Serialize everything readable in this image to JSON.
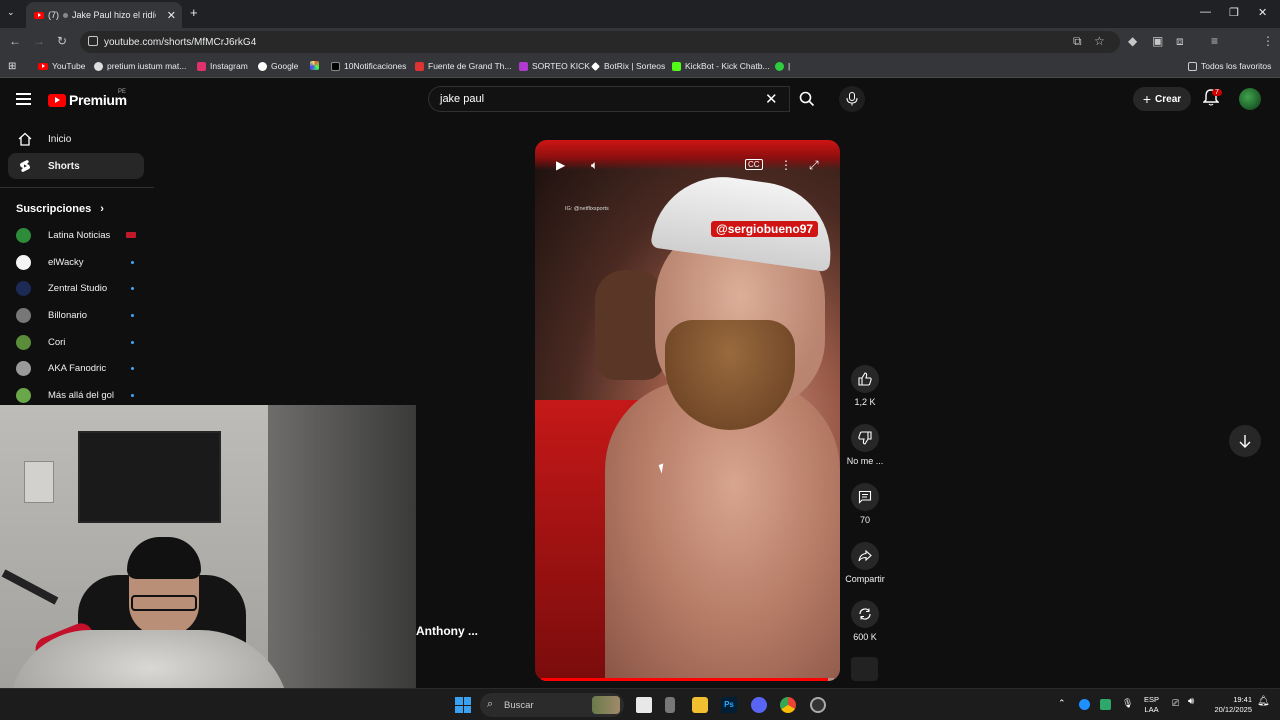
{
  "browser": {
    "tab_count_prefix": "(7)",
    "tab_title": "Jake Paul hizo el ridíc",
    "url": "youtube.com/shorts/MfMCrJ6rkG4",
    "bookmarks": [
      "YouTube",
      "pretium iustum mat...",
      "Instagram",
      "Google",
      "10Notificaciones",
      "Fuente de Grand Th...",
      "SORTEO KICK",
      "BotRix | Sorteos",
      "KickBot - Kick Chatb...",
      "|"
    ],
    "all_bookmarks": "Todos los favoritos"
  },
  "header": {
    "logo_text": "Premium",
    "country_code": "PE",
    "search_value": "jake paul",
    "create_label": "Crear",
    "notification_count": "7"
  },
  "sidebar": {
    "items": [
      {
        "label": "Inicio",
        "icon": "home-icon"
      },
      {
        "label": "Shorts",
        "icon": "shorts-icon"
      }
    ],
    "subs_heading": "Suscripciones",
    "subs": [
      {
        "label": "Latina Noticias",
        "color": "#2e8b3a"
      },
      {
        "label": "elWacky",
        "color": "#f4f4f4"
      },
      {
        "label": "Zentral Studio",
        "color": "#1c2a55"
      },
      {
        "label": "Billonario",
        "color": "#777777"
      },
      {
        "label": "Cori",
        "color": "#5a8c3a"
      },
      {
        "label": "AKA Fanodric",
        "color": "#9a9a9a"
      },
      {
        "label": "Más allá del gol",
        "color": "#6aa64a"
      }
    ]
  },
  "player": {
    "overlay_tag": "@sergiobueno97",
    "watermark": "IG: @netflixsports",
    "progress": 0.98
  },
  "actions": {
    "likes": "1,2 K",
    "dislike": "No me ...",
    "comments": "70",
    "share": "Compartir",
    "remix": "600 K"
  },
  "author": "Anthony ...",
  "taskbar": {
    "search_placeholder": "Buscar",
    "lang_line1": "ESP",
    "lang_line2": "LAA",
    "time": "19:41",
    "date": "20/12/2025"
  }
}
